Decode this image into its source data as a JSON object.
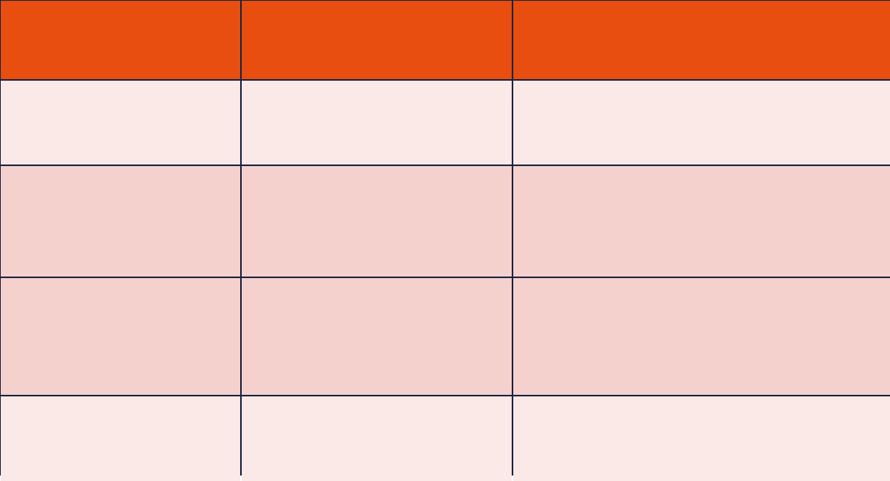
{
  "table": {
    "colors": {
      "header": "#E84E10",
      "row_light": "#FBE9E7",
      "row_dark": "#F5D1CE",
      "border": "#1C2541"
    },
    "headers": [
      "",
      "",
      ""
    ],
    "rows": [
      [
        "",
        "",
        ""
      ],
      [
        "",
        "",
        ""
      ],
      [
        "",
        "",
        ""
      ],
      [
        "",
        "",
        ""
      ]
    ]
  }
}
